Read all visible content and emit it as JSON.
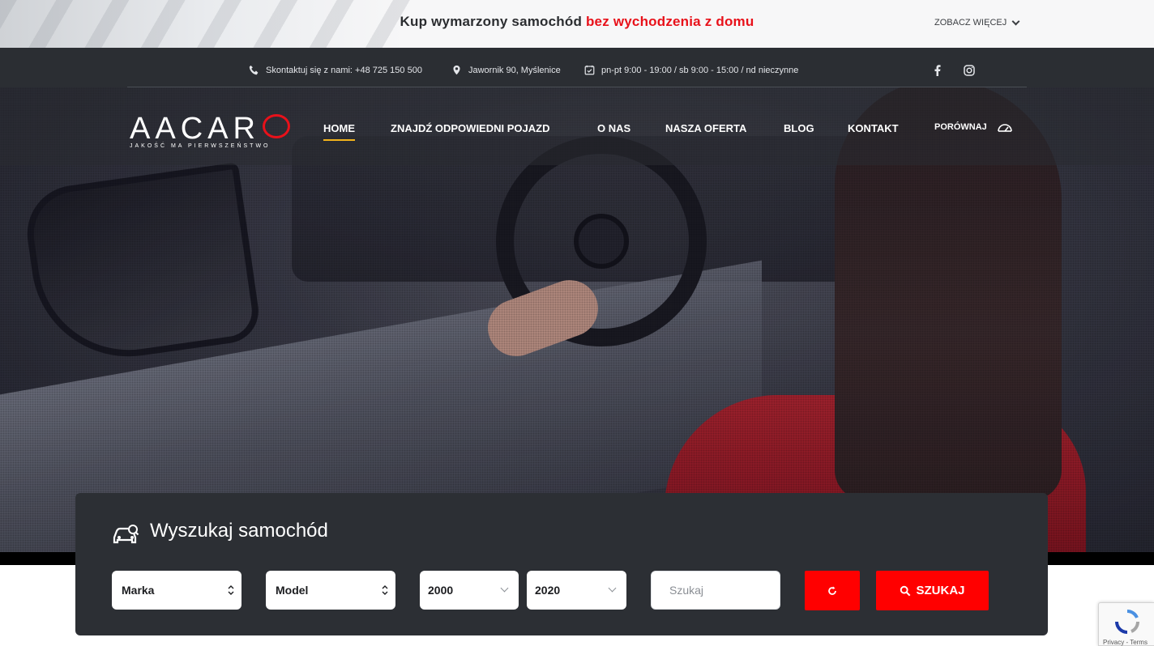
{
  "promo": {
    "text_main": "Kup wymarzony samochód ",
    "text_accent": "bez wychodzenia z domu",
    "more_label": "ZOBACZ WIĘCEJ"
  },
  "infobar": {
    "phone": "Skontaktuj się z nami: +48 725 150 500",
    "address": "Jawornik 90, Myślenice",
    "hours": "pn-pt 9:00 - 19:00 / sb 9:00 - 15:00 / nd nieczynne",
    "social": [
      "facebook-icon",
      "instagram-icon"
    ]
  },
  "logo": {
    "brand": "AACAR",
    "tagline": "JAKOŚĆ MA PIERWSZEŃSTWO"
  },
  "nav": {
    "items": [
      "HOME",
      "ZNAJDŹ ODPOWIEDNI POJAZD",
      "O NAS",
      "NASZA OFERTA",
      "BLOG",
      "KONTAKT"
    ],
    "active": "HOME",
    "compare_label": "PORÓWNAJ"
  },
  "search": {
    "title": "Wyszukaj samochód",
    "make": "Marka",
    "model": "Model",
    "year_from": "2000",
    "year_to": "2020",
    "query_placeholder": "Szukaj",
    "search_label": "SZUKAJ"
  },
  "recaptcha": {
    "legal": "Privacy - Terms"
  },
  "colors": {
    "accent_red": "#e8111a",
    "button_red": "#ff0000",
    "active_underline": "#f2b31c",
    "dark_bar": "#2b2e33",
    "panel": "#2c2f34"
  }
}
